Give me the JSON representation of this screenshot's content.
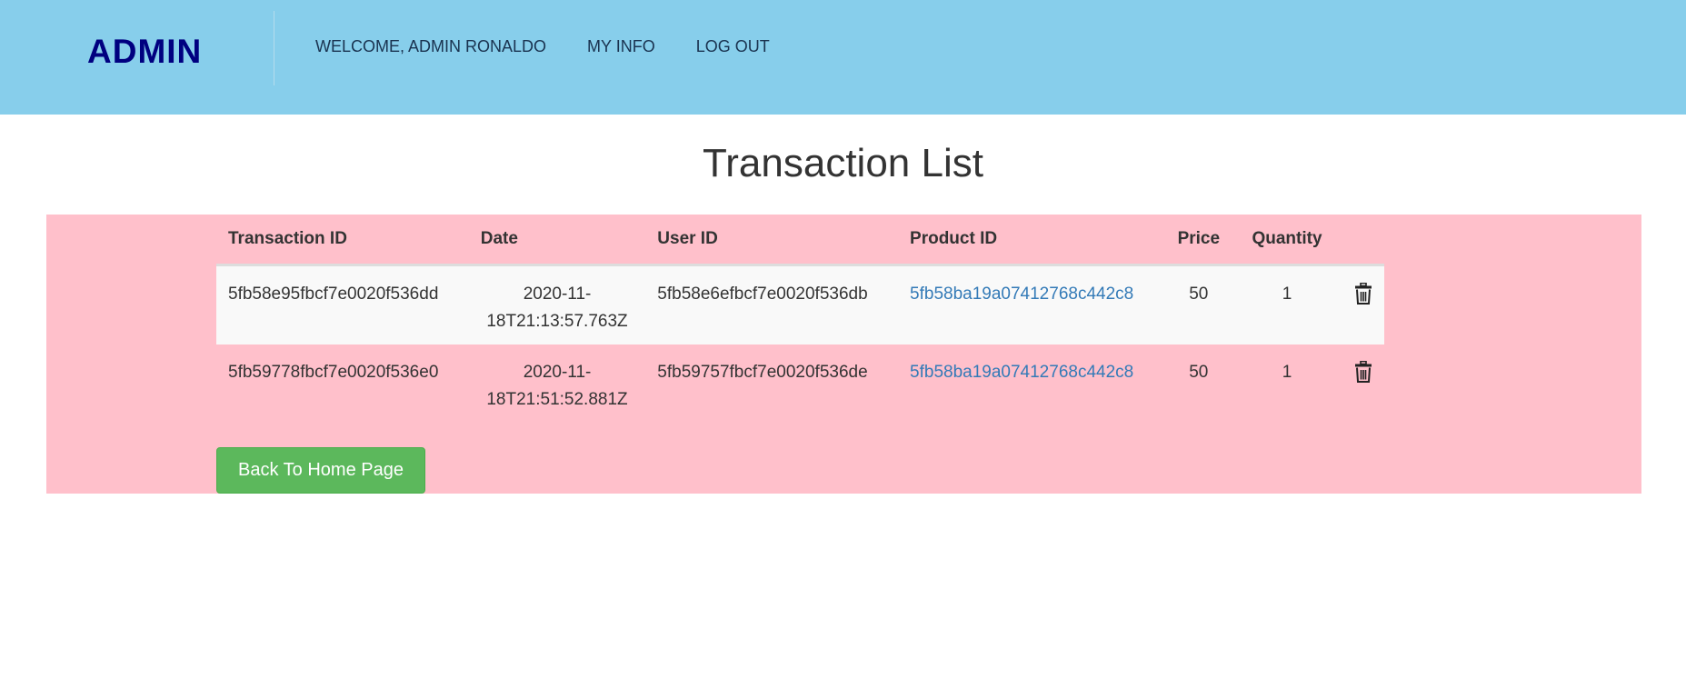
{
  "nav": {
    "brand": "ADMIN",
    "links": [
      "WELCOME, ADMIN RONALDO",
      "MY INFO",
      "LOG OUT"
    ]
  },
  "page": {
    "title": "Transaction List",
    "back_button": "Back To Home Page"
  },
  "table": {
    "headers": [
      "Transaction ID",
      "Date",
      "User ID",
      "Product ID",
      "Price",
      "Quantity"
    ],
    "rows": [
      {
        "transaction_id": "5fb58e95fbcf7e0020f536dd",
        "date_line1": "2020-11-",
        "date_line2": "18T21:13:57.763Z",
        "user_id": "5fb58e6efbcf7e0020f536db",
        "product_id": "5fb58ba19a07412768c442c8",
        "price": "50",
        "quantity": "1",
        "action_icon": "trash-icon"
      },
      {
        "transaction_id": "5fb59778fbcf7e0020f536e0",
        "date_line1": "2020-11-",
        "date_line2": "18T21:51:52.881Z",
        "user_id": "5fb59757fbcf7e0020f536de",
        "product_id": "5fb58ba19a07412768c442c8",
        "price": "50",
        "quantity": "1",
        "action_icon": "trash-icon"
      }
    ]
  },
  "colors": {
    "navbar": "#87ceeb",
    "brand": "#000080",
    "panel": "#ffc0cb",
    "link": "#337ab7",
    "button": "#5cb85c"
  }
}
